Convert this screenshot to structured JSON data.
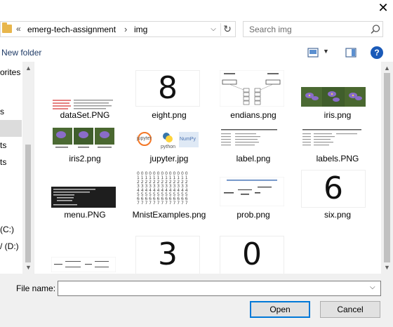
{
  "window": {
    "close_glyph": "✕"
  },
  "address": {
    "sep1": "«",
    "crumbs": [
      "emerg-tech-assignment",
      "img"
    ],
    "sep2": "›"
  },
  "search": {
    "placeholder": "Search img"
  },
  "toolbar": {
    "new_folder": "New folder",
    "help": "?"
  },
  "nav": {
    "items": [
      "orites",
      "s",
      "ts",
      "ts",
      "(C:)",
      "/ (D:)"
    ]
  },
  "files": [
    {
      "name": "dataSet.PNG"
    },
    {
      "name": "eight.png",
      "digit": "8"
    },
    {
      "name": "endians.png"
    },
    {
      "name": "iris.png"
    },
    {
      "name": "iris2.png"
    },
    {
      "name": "jupyter.jpg",
      "logo_text_1": "jupyter",
      "logo_text_2": "python",
      "logo_text_3": "NumPy"
    },
    {
      "name": "label.png"
    },
    {
      "name": "labels.PNG"
    },
    {
      "name": "menu.PNG"
    },
    {
      "name": "MnistExamples.png"
    },
    {
      "name": "prob.png"
    },
    {
      "name": "six.png",
      "digit": "6"
    },
    {
      "name": "",
      "digit": ""
    },
    {
      "name": "",
      "digit": "3"
    },
    {
      "name": "",
      "digit": "0"
    }
  ],
  "footer": {
    "file_name_label": "File name:",
    "file_name_value": "",
    "open": "Open",
    "cancel": "Cancel"
  }
}
